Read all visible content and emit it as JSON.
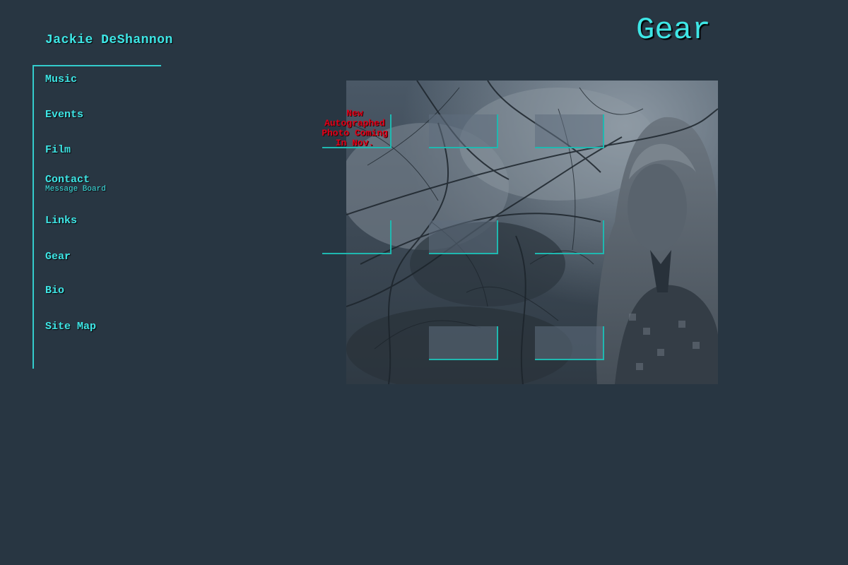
{
  "site": {
    "title": "Jackie DeShannon"
  },
  "page": {
    "title": "Gear"
  },
  "nav": {
    "items": [
      {
        "label": "Music"
      },
      {
        "label": "Events"
      },
      {
        "label": "Film"
      },
      {
        "label": "Contact"
      },
      {
        "label": "Links"
      },
      {
        "label": "Gear"
      },
      {
        "label": "Bio"
      },
      {
        "label": "Site Map"
      }
    ],
    "sub": {
      "label": "Message Board"
    }
  },
  "notice": {
    "lines": [
      "New",
      "Autographed",
      "Photo Coming",
      "In Nov."
    ]
  },
  "colors": {
    "background": "#283642",
    "accent": "#3ee6e6",
    "notice": "#e0001a"
  }
}
